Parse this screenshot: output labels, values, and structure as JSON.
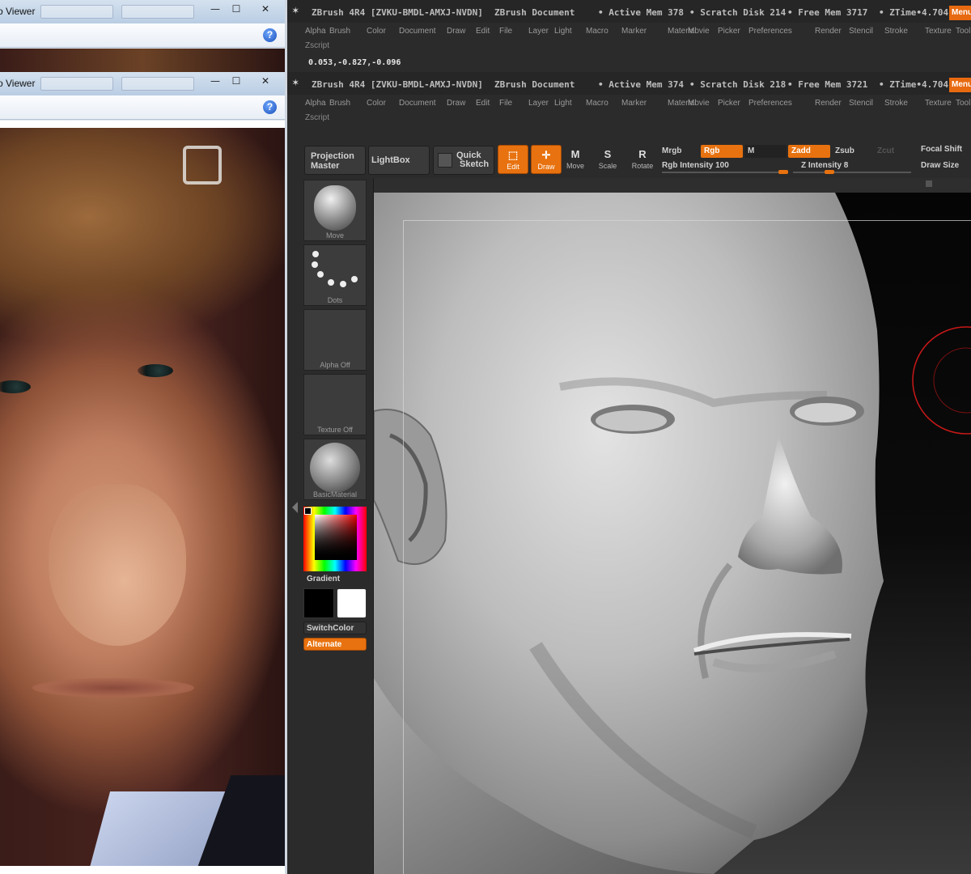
{
  "photo_viewer": {
    "title": "o Viewer",
    "buttons": {
      "minimize": "—",
      "maximize": "☐",
      "close": "✕"
    },
    "help": "?"
  },
  "zbrush_back": {
    "title": "ZBrush 4R4 [ZVKU-BMDL-AMXJ-NVDN]",
    "doc": "ZBrush Document",
    "active_mem": "• Active Mem 378",
    "scratch": "• Scratch Disk 214",
    "free_mem": "• Free Mem 3717",
    "ztime": "• ZTime•4.704",
    "menu": "Menu",
    "zscript": "Zscript",
    "coords": "0.053,-0.827,-0.096"
  },
  "zbrush_front": {
    "title": "ZBrush 4R4 [ZVKU-BMDL-AMXJ-NVDN]",
    "doc": "ZBrush Document",
    "active_mem": "• Active Mem 374",
    "scratch": "• Scratch Disk 218",
    "free_mem": "• Free Mem 3721",
    "ztime": "• ZTime•4.704",
    "menu": "Menu",
    "zscript": "Zscript"
  },
  "menus": [
    "Alpha",
    "Brush",
    "Color",
    "Document",
    "Draw",
    "Edit",
    "File",
    "Layer",
    "Light",
    "Macro",
    "Marker",
    "Material",
    "Movie",
    "Picker",
    "Preferences",
    "Render",
    "Stencil",
    "Stroke",
    "Texture",
    "Tool"
  ],
  "toolbar": {
    "projection_master_1": "Projection",
    "projection_master_2": "Master",
    "lightbox": "LightBox",
    "quick_sketch_1": "Quick",
    "quick_sketch_2": "Sketch",
    "edit": "Edit",
    "draw": "Draw",
    "move": "Move",
    "scale": "Scale",
    "rotate": "Rotate",
    "mrgb": "Mrgb",
    "rgb": "Rgb",
    "m": "M",
    "zadd": "Zadd",
    "zsub": "Zsub",
    "zcut": "Zcut",
    "rgb_intensity": "Rgb Intensity 100",
    "z_intensity": "Z Intensity 8",
    "focal_shift": "Focal Shift",
    "draw_size": "Draw Size",
    "rgb_intensity_value": 100,
    "z_intensity_value": 8
  },
  "tray": {
    "brush": "Move",
    "stroke": "Dots",
    "alpha": "Alpha Off",
    "texture": "Texture Off",
    "material": "BasicMaterial",
    "gradient": "Gradient",
    "switch_color": "SwitchColor",
    "alternate": "Alternate"
  },
  "icons": {
    "help": "help-icon",
    "zbrush_logo": "zbrush-logo-icon",
    "edit": "edit-icon",
    "draw": "draw-icon",
    "move": "move-icon",
    "scale": "scale-icon",
    "rotate": "rotate-icon"
  },
  "colors": {
    "accent": "#e8720f",
    "canvas_bg": "#050505",
    "brush_cursor": "#c81818",
    "main_color": "#000000",
    "secondary_color": "#ffffff"
  }
}
